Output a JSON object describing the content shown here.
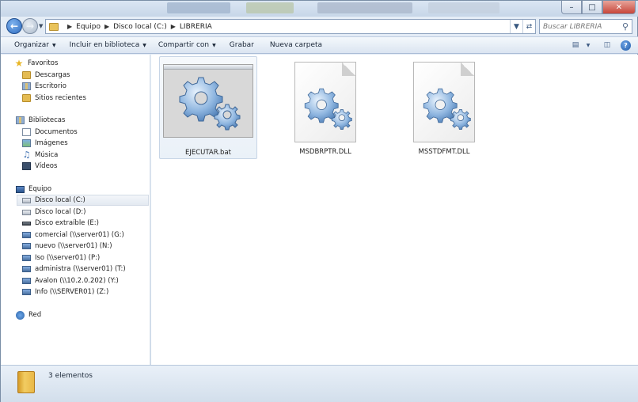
{
  "address": {
    "segments": [
      "Equipo",
      "Disco local (C:)",
      "LIBRERIA"
    ],
    "search_placeholder": "Buscar LIBRERIA"
  },
  "toolbar": {
    "organize": "Organizar",
    "include_library": "Incluir en biblioteca",
    "share": "Compartir con",
    "burn": "Grabar",
    "new_folder": "Nueva carpeta"
  },
  "sidebar": {
    "favorites": {
      "label": "Favoritos",
      "items": [
        "Descargas",
        "Escritorio",
        "Sitios recientes"
      ]
    },
    "libraries": {
      "label": "Bibliotecas",
      "items": [
        "Documentos",
        "Imágenes",
        "Música",
        "Vídeos"
      ]
    },
    "computer": {
      "label": "Equipo",
      "items": [
        "Disco local (C:)",
        "Disco local (D:)",
        "Disco extraíble (E:)",
        "comercial (\\\\server01) (G:)",
        "nuevo (\\\\server01) (N:)",
        "Iso (\\\\server01) (P:)",
        "administra (\\\\server01) (T:)",
        "Avalon (\\\\10.2.0.202) (Y:)",
        "Info (\\\\SERVER01) (Z:)"
      ],
      "selected_index": 0
    },
    "network": {
      "label": "Red"
    }
  },
  "files": [
    {
      "name": "EJECUTAR.bat",
      "type": "bat",
      "selected": true
    },
    {
      "name": "MSDBRPTR.DLL",
      "type": "dll",
      "selected": false
    },
    {
      "name": "MSSTDFMT.DLL",
      "type": "dll",
      "selected": false
    }
  ],
  "status": {
    "count_text": "3 elementos"
  },
  "icons": {
    "back": "back-arrow-icon",
    "forward": "forward-arrow-icon",
    "refresh": "refresh-icon",
    "search": "search-icon",
    "help": "help-icon",
    "views": "view-options-icon",
    "preview": "preview-pane-icon"
  }
}
